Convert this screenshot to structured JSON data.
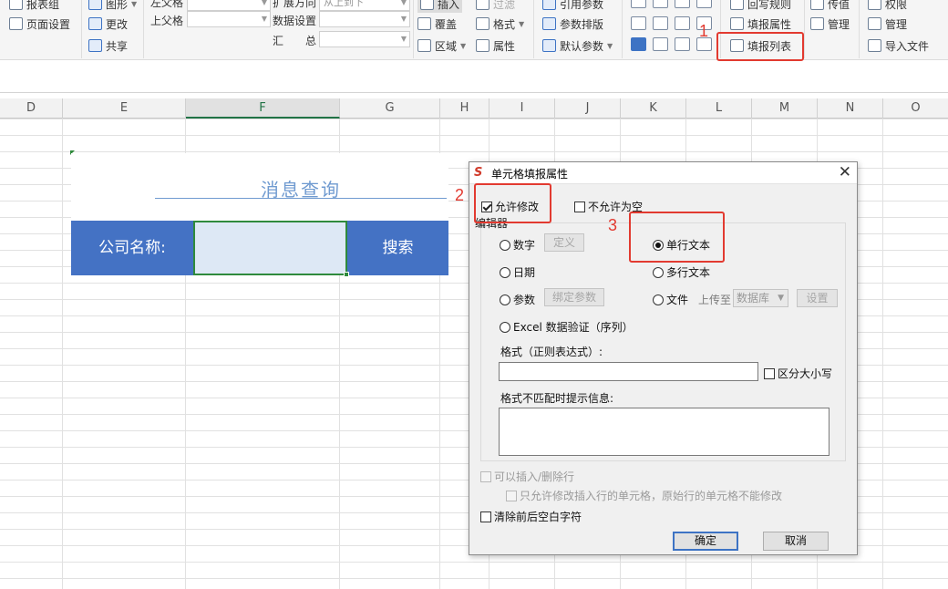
{
  "ribbon": {
    "report_group_label": "报表组",
    "page_setup": "页面设置",
    "graphic": "图形",
    "change": "更改",
    "share": "共享",
    "left_parent": "左父格",
    "upper_parent": "上父格",
    "expand_direction": "扩展方向",
    "expand_value": "从上到下",
    "data_setting": "数据设置",
    "summary": "汇　　总",
    "insert": "插入",
    "filter": "过滤",
    "cover": "覆盖",
    "style": "格式",
    "region": "区域",
    "attribute": "属性",
    "ref_param": "引用参数",
    "param_layout": "参数排版",
    "default_param": "默认参数",
    "write_rule": "回写规则",
    "fill_attr": "填报属性",
    "fill_list": "填报列表",
    "transfer": "传值",
    "manage": "管理",
    "permission": "权限",
    "manage2": "管理",
    "import_file": "导入文件"
  },
  "columns": [
    {
      "label": "D",
      "width": 69
    },
    {
      "label": "E",
      "width": 135
    },
    {
      "label": "F",
      "width": 169
    },
    {
      "label": "G",
      "width": 110
    },
    {
      "label": "H",
      "width": 54
    },
    {
      "label": "I",
      "width": 72
    },
    {
      "label": "J",
      "width": 72
    },
    {
      "label": "K",
      "width": 72
    },
    {
      "label": "L",
      "width": 72
    },
    {
      "label": "M",
      "width": 72
    },
    {
      "label": "N",
      "width": 72
    },
    {
      "label": "O",
      "width": 72
    }
  ],
  "active_column": "F",
  "report": {
    "title": "消息查询",
    "company_label": "公司名称:",
    "search_label": "搜索",
    "bar_color": "#4472c4"
  },
  "annotations": [
    "1",
    "2",
    "3"
  ],
  "dialog": {
    "title": "单元格填报属性",
    "allow_modify": "允许修改",
    "not_empty": "不允许为空",
    "editor_group": "编辑器",
    "number": "数字",
    "define": "定义",
    "date": "日期",
    "param": "参数",
    "bind_param": "绑定参数",
    "excel_validation": "Excel 数据验证（序列）",
    "single_line": "单行文本",
    "multi_line": "多行文本",
    "file": "文件",
    "upload_to": "上传至",
    "database": "数据库",
    "setting": "设置",
    "regex_label": "格式（正则表达式）:",
    "case_sensitive": "区分大小写",
    "mismatch_label": "格式不匹配时提示信息:",
    "insert_delete_rows": "可以插入/删除行",
    "only_inserted_rows": "只允许修改插入行的单元格，原始行的单元格不能修改",
    "trim_whitespace": "清除前后空白字符",
    "ok": "确定",
    "cancel": "取消",
    "editor_selected": "single_line",
    "allow_modify_checked": true
  }
}
